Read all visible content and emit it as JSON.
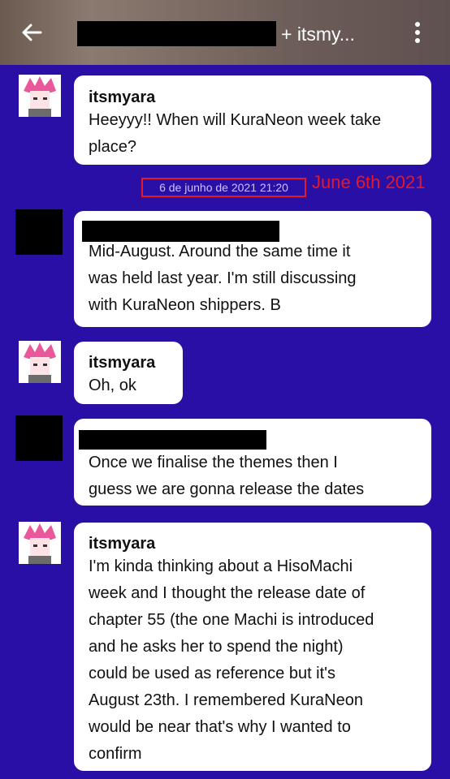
{
  "header": {
    "title_suffix": "+ itsmy..."
  },
  "messages": [
    {
      "sender": "itsmyara",
      "lines": [
        "Heeyyy!! When will KuraNeon week take",
        "place?"
      ]
    },
    {
      "sender": "",
      "lines": [
        "Mid-August. Around the same time it",
        "was held last year. I'm still discussing",
        "with KuraNeon shippers. B"
      ]
    },
    {
      "sender": "itsmyara",
      "lines": [
        "Oh, ok"
      ]
    },
    {
      "sender": "",
      "lines": [
        "Once we finalise the themes then I",
        "guess we are gonna release the dates"
      ]
    },
    {
      "sender": "itsmyara",
      "lines": [
        "I'm kinda thinking about a HisoMachi",
        "week and I thought the release date of",
        "chapter 55 (the one Machi is introduced",
        "and he asks her to spend the night)",
        "could be used as reference but it's",
        "August 23th. I remembered KuraNeon",
        "would be near that's why I wanted to",
        "confirm"
      ]
    }
  ],
  "timestamp": "6 de junho de 2021 21:20",
  "annotation": "June 6th 2021",
  "colors": {
    "background": "#2a0fa6",
    "annotation_red": "#e3192b"
  }
}
